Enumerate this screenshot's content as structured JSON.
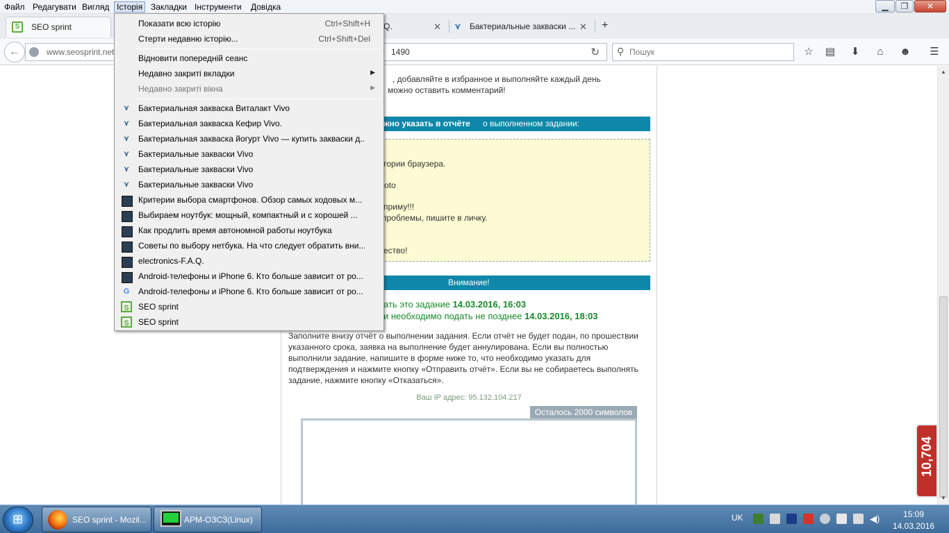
{
  "menubar": {
    "items": [
      "Файл",
      "Редагувати",
      "Вигляд",
      "Історія",
      "Закладки",
      "Інструменти",
      "Довідка"
    ],
    "active_index": 3
  },
  "window": {
    "minimize": "▁",
    "restore": "❐",
    "close": "✕"
  },
  "tabs": [
    {
      "label": "SEO sprint",
      "close": "✕",
      "favicon": "seo-sprint-icon"
    },
    {
      "label": "Q.",
      "close": "✕"
    },
    {
      "label": "Бактериальные закваски ...",
      "close": "✕",
      "favicon": "vivo-icon"
    }
  ],
  "new_tab": "+",
  "nav": {
    "url_domain": "www.seosprint.net",
    "url_tail": "1490",
    "search_placeholder": "Пошук"
  },
  "history_menu": {
    "top_items": [
      {
        "label": "Показати всю історію",
        "shortcut": "Ctrl+Shift+H"
      },
      {
        "label": "Стерти недавню історію...",
        "shortcut": "Ctrl+Shift+Del"
      }
    ],
    "session_items": [
      {
        "label": "Відновити попередній сеанс",
        "submenu": false,
        "disabled": false
      },
      {
        "label": "Недавно закриті вкладки",
        "submenu": true,
        "disabled": false
      },
      {
        "label": "Недавно закриті вікна",
        "submenu": true,
        "disabled": true
      }
    ],
    "history_items": [
      {
        "label": "Бактериальная закваска Виталакт Vivo",
        "icon": "vivo-icon"
      },
      {
        "label": "Бактериальная закваска Кефир Vivo.",
        "icon": "vivo-icon"
      },
      {
        "label": "Бактериальная закваска йогурт Vivo — купить закваски д...",
        "icon": "vivo-icon"
      },
      {
        "label": "Бактериальные закваски Vivo",
        "icon": "vivo-icon"
      },
      {
        "label": "Бактериальные закваски Vivo",
        "icon": "vivo-icon"
      },
      {
        "label": "Бактериальные закваски Vivo",
        "icon": "vivo-icon"
      },
      {
        "label": "Критерии выбора смартфонов. Обзор самых ходовых м...",
        "icon": "laptop-icon"
      },
      {
        "label": "Выбираем ноутбук: мощный, компактный и с хорошей ...",
        "icon": "laptop-icon"
      },
      {
        "label": "Как продлить время автономной работы ноутбука",
        "icon": "laptop-icon"
      },
      {
        "label": "Советы по выбору нетбука. На что следует обратить вни...",
        "icon": "laptop-icon"
      },
      {
        "label": "electronics-F.A.Q.",
        "icon": "laptop-icon"
      },
      {
        "label": "Android-телефоны и iPhone 6. Кто больше зависит от ро...",
        "icon": "laptop-icon"
      },
      {
        "label": "Android-телефоны и iPhone 6. Кто больше зависит от ро...",
        "icon": "google-icon"
      },
      {
        "label": "SEO sprint",
        "icon": "seo-sprint-icon"
      },
      {
        "label": "SEO sprint",
        "icon": "seo-sprint-icon"
      }
    ]
  },
  "page": {
    "intro_line1": ", добавляйте в избранное и выполняйте каждый день",
    "intro_line2": "можно оставить комментарий!",
    "report_header_bold": "жно указать в отчёте",
    "report_header_rest": " о выполненном задании:",
    "yellow_lines": [
      "тории браузера.",
      "oto",
      "приму!!!",
      "проблемы, пишите в личку.",
      "ество!"
    ],
    "attention": "Внимание!",
    "deadline1_prefix": "ать это задание ",
    "deadline1_value": "14.03.2016, 16:03",
    "deadline2_prefix": "и необходимо подать не позднее ",
    "deadline2_value": "14.03.2016, 18:03",
    "paragraph": "Заполните внизу отчёт о выполнении задания. Если отчёт не будет подан, по прошествии указанного срока, заявка на выполнение будет аннулирована. Если вы полностью выполнили задание, напишите в форме ниже то, что необходимо указать для подтверждения и нажмите кнопку «Отправить отчёт». Если вы не собираетесь выполнять задание, нажмите кнопку «Отказаться».",
    "ip_line": "Ваш IP адрес: 95.132.104.217",
    "char_counter": "Осталось 2000 символов",
    "widget_value": "10,704"
  },
  "taskbar": {
    "items": [
      {
        "label": "SEO sprint - Mozil...",
        "icon": "firefox-icon"
      },
      {
        "label": "АРМ-ОЗСЗ(Linux)",
        "icon": "terminal-icon"
      }
    ],
    "lang": "UK",
    "time": "15:09",
    "date": "14.03.2016"
  },
  "colors": {
    "accent_blue": "#0f87a8",
    "deadline_green": "#178a2a",
    "yellow_box": "#fdfbd3"
  }
}
